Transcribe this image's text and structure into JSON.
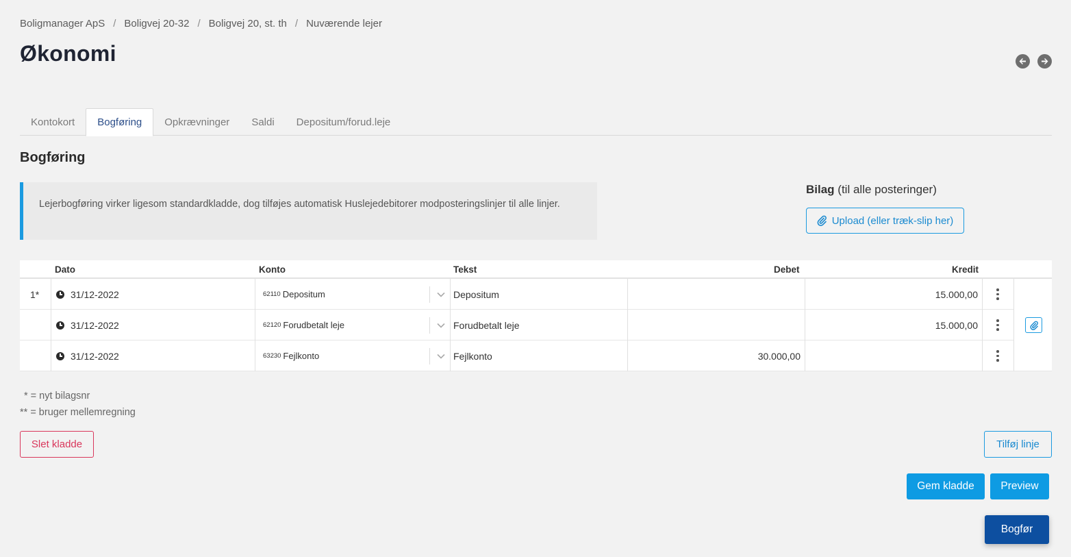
{
  "breadcrumb": [
    "Boligmanager ApS",
    "Boligvej 20-32",
    "Boligvej 20, st. th",
    "Nuværende lejer"
  ],
  "breadcrumb_separator": "/",
  "page_title": "Økonomi",
  "tabs": [
    {
      "label": "Kontokort",
      "active": false
    },
    {
      "label": "Bogføring",
      "active": true
    },
    {
      "label": "Opkrævninger",
      "active": false
    },
    {
      "label": "Saldi",
      "active": false
    },
    {
      "label": "Depositum/forud.leje",
      "active": false
    }
  ],
  "section_title": "Bogføring",
  "info_text": "Lejerbogføring virker ligesom standardkladde, dog tilføjes automatisk Huslejedebitorer modposteringslinjer til alle linjer.",
  "bilag": {
    "title_bold": "Bilag",
    "title_rest": "(til alle posteringer)",
    "upload_label": "Upload (eller træk-slip her)"
  },
  "table": {
    "headers": {
      "dato": "Dato",
      "konto": "Konto",
      "tekst": "Tekst",
      "debet": "Debet",
      "kredit": "Kredit"
    },
    "rows": [
      {
        "rownum": "1*",
        "dato": "31/12-2022",
        "konto_num": "62110",
        "konto_name": "Depositum",
        "tekst": "Depositum",
        "debet": "",
        "kredit": "15.000,00"
      },
      {
        "rownum": "",
        "dato": "31/12-2022",
        "konto_num": "62120",
        "konto_name": "Forudbetalt leje",
        "tekst": "Forudbetalt leje",
        "debet": "",
        "kredit": "15.000,00"
      },
      {
        "rownum": "",
        "dato": "31/12-2022",
        "konto_num": "63230",
        "konto_name": "Fejlkonto",
        "tekst": "Fejlkonto",
        "debet": "30.000,00",
        "kredit": ""
      }
    ]
  },
  "legend": [
    "* = nyt bilagsnr",
    "** = bruger mellemregning"
  ],
  "buttons": {
    "delete_draft": "Slet kladde",
    "add_line": "Tilføj linje",
    "save_draft": "Gem kladde",
    "preview": "Preview",
    "post": "Bogfør"
  },
  "colors": {
    "accent": "#1a9ae0",
    "primary_dark": "#0d4fa0",
    "danger": "#d9365b",
    "background": "#f2f2f2"
  },
  "icons": {
    "nav_prev": "arrow-left-circle-icon",
    "nav_next": "arrow-right-circle-icon",
    "upload": "paperclip-icon",
    "date": "clock-icon",
    "dropdown": "chevron-down-icon",
    "row_menu": "kebab-menu-icon",
    "attach": "paperclip-icon"
  }
}
